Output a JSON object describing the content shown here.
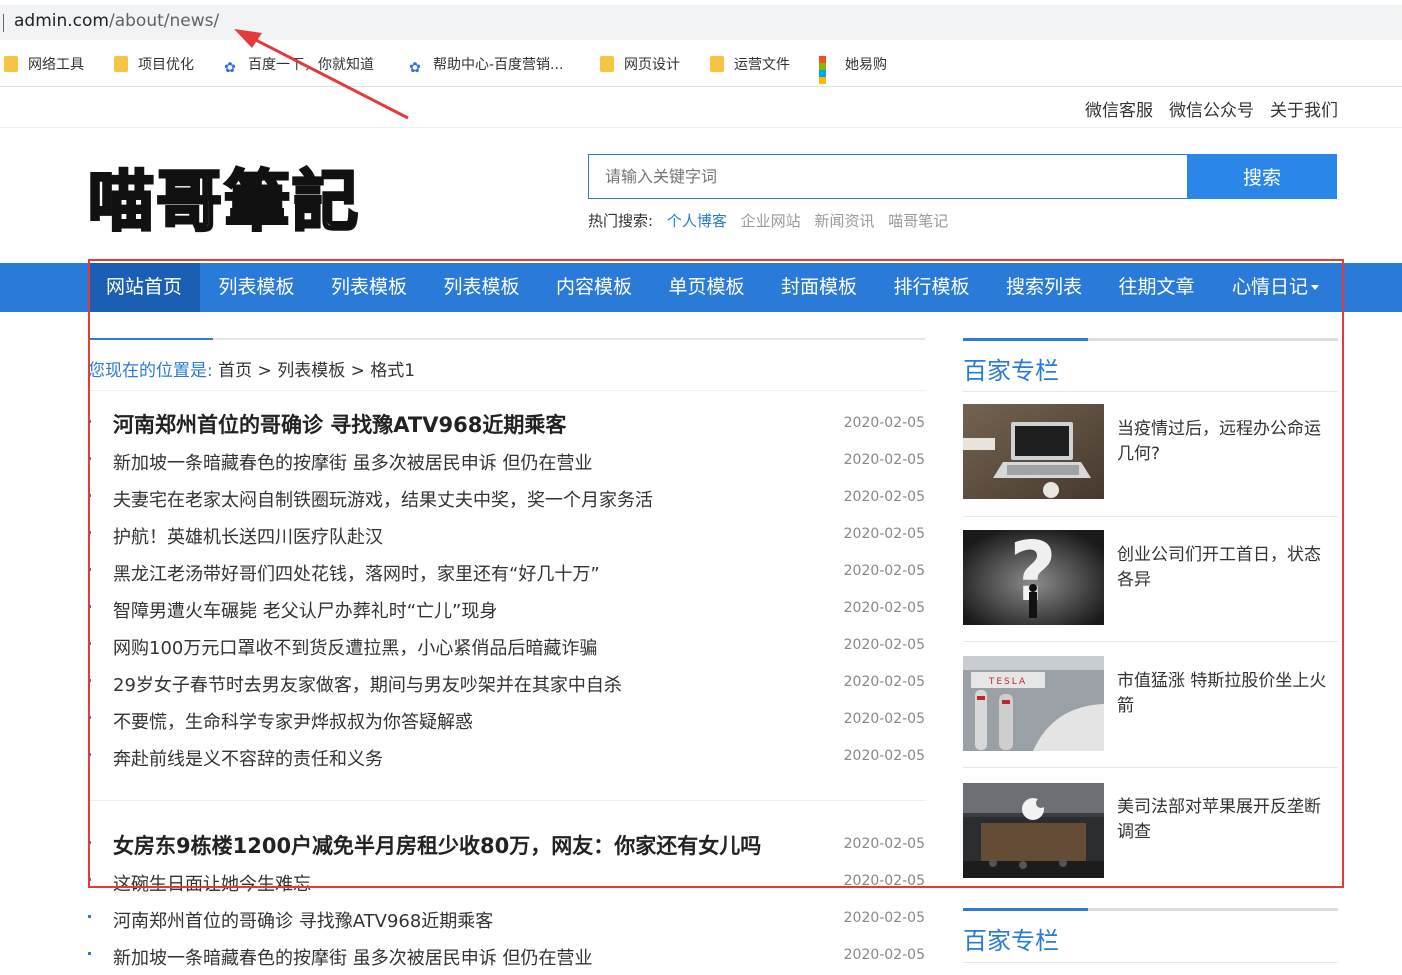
{
  "browser": {
    "url_host": "admin.com",
    "url_path": "/about/news/",
    "bookmarks": [
      {
        "label": "网络工具",
        "icon": "folder-icon"
      },
      {
        "label": "项目优化",
        "icon": "folder-icon"
      },
      {
        "label": "百度一下，你就知道",
        "icon": "baidu-paw-icon"
      },
      {
        "label": "帮助中心-百度营销...",
        "icon": "baidu-paw-icon"
      },
      {
        "label": "网页设计",
        "icon": "folder-icon"
      },
      {
        "label": "运营文件",
        "icon": "folder-icon"
      },
      {
        "label": "她易购",
        "icon": "windows-icon"
      }
    ]
  },
  "topnav": [
    "微信客服",
    "微信公众号",
    "关于我们"
  ],
  "logo_text": "喵哥筆記",
  "search": {
    "placeholder": "请输入关键字词",
    "button": "搜索",
    "hot_label": "热门搜索:",
    "hot_keywords": [
      "个人博客",
      "企业网站",
      "新闻资讯",
      "喵哥笔记"
    ]
  },
  "nav": [
    "网站首页",
    "列表模板",
    "列表模板",
    "列表模板",
    "内容模板",
    "单页模板",
    "封面模板",
    "排行模板",
    "搜索列表",
    "往期文章",
    "心情日记"
  ],
  "breadcrumb": {
    "prefix": "您现在的位置是:",
    "path": "首页 > 列表模板 > 格式1"
  },
  "list_blocks": [
    {
      "headline": {
        "title": "河南郑州首位的哥确诊 寻找豫ATV968近期乘客",
        "date": "2020-02-05"
      },
      "items": [
        {
          "title": "新加坡一条暗藏春色的按摩街 虽多次被居民申诉 但仍在营业",
          "date": "2020-02-05"
        },
        {
          "title": "夫妻宅在老家太闷自制铁圈玩游戏，结果丈夫中奖，奖一个月家务活",
          "date": "2020-02-05"
        },
        {
          "title": "护航！英雄机长送四川医疗队赴汉",
          "date": "2020-02-05"
        },
        {
          "title": "黑龙江老汤带好哥们四处花钱，落网时，家里还有“好几十万”",
          "date": "2020-02-05"
        },
        {
          "title": "智障男遭火车碾毙 老父认尸办葬礼时“亡儿”现身",
          "date": "2020-02-05"
        },
        {
          "title": "网购100万元口罩收不到货反遭拉黑，小心紧俏品后暗藏诈骗",
          "date": "2020-02-05"
        },
        {
          "title": "29岁女子春节时去男友家做客，期间与男友吵架并在其家中自杀",
          "date": "2020-02-05"
        },
        {
          "title": "不要慌，生命科学专家尹烨叔叔为你答疑解惑",
          "date": "2020-02-05"
        },
        {
          "title": "奔赴前线是义不容辞的责任和义务",
          "date": "2020-02-05"
        }
      ]
    },
    {
      "headline": {
        "title": "女房东9栋楼1200户减免半月房租少收80万，网友：你家还有女儿吗",
        "date": "2020-02-05"
      },
      "items": [
        {
          "title": "这碗生日面让她今生难忘",
          "date": "2020-02-05"
        },
        {
          "title": "河南郑州首位的哥确诊 寻找豫ATV968近期乘客",
          "date": "2020-02-05"
        },
        {
          "title": "新加坡一条暗藏春色的按摩街 虽多次被居民申诉 但仍在营业",
          "date": "2020-02-05"
        }
      ]
    }
  ],
  "sidebar": {
    "title": "百家专栏",
    "title2": "百家专栏",
    "cards": [
      {
        "text": "当疫情过后，远程办公命运几何?",
        "image": "laptop-desk-image"
      },
      {
        "text": "创业公司们开工首日，状态各异",
        "image": "question-mark-image"
      },
      {
        "text": "市值猛涨 特斯拉股价坐上火箭",
        "image": "tesla-charger-image",
        "sign": "TESLA"
      },
      {
        "text": "美司法部对苹果展开反垄断调查",
        "image": "apple-store-image"
      }
    ]
  },
  "colors": {
    "accent": "#2a7bd8",
    "nav_active": "#1a5fb4",
    "annotation": "#e23b3b"
  }
}
